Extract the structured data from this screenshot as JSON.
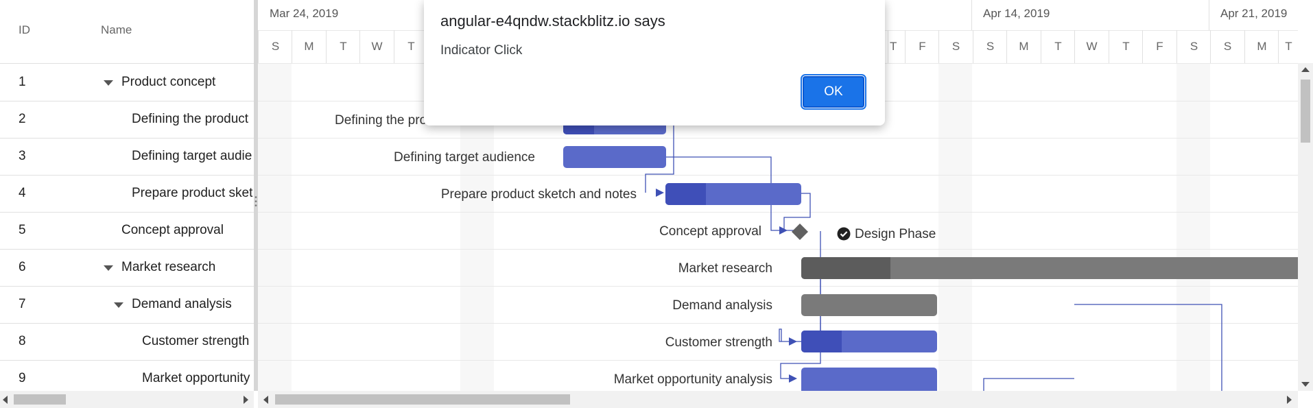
{
  "grid": {
    "columns": {
      "id": "ID",
      "name": "Name"
    },
    "rows": [
      {
        "id": "1",
        "name": "Product concept",
        "expandable": true
      },
      {
        "id": "2",
        "name": "Defining the product",
        "expandable": false
      },
      {
        "id": "3",
        "name": "Defining target audie",
        "expandable": false
      },
      {
        "id": "4",
        "name": "Prepare product sket",
        "expandable": false
      },
      {
        "id": "5",
        "name": "Concept approval",
        "expandable": false
      },
      {
        "id": "6",
        "name": "Market research",
        "expandable": true
      },
      {
        "id": "7",
        "name": "Demand analysis",
        "expandable": true
      },
      {
        "id": "8",
        "name": "Customer strength",
        "expandable": false
      },
      {
        "id": "9",
        "name": "Market opportunity",
        "expandable": false
      }
    ]
  },
  "chart": {
    "weeks": [
      "Mar 24, 2019",
      "Apr 14, 2019",
      "Apr 21, 2019"
    ],
    "days_left": [
      "S",
      "M",
      "T",
      "W",
      "T"
    ],
    "days_right": [
      "T",
      "F",
      "S",
      "S",
      "M",
      "T",
      "W",
      "T",
      "F",
      "S",
      "S",
      "M",
      "T"
    ],
    "task_labels": {
      "defining_product": "Defining the pro",
      "defining_audience": "Defining target audience",
      "prepare_sketch": "Prepare product sketch and notes",
      "concept_approval": "Concept approval",
      "market_research": "Market research",
      "demand_analysis": "Demand analysis",
      "customer_strength": "Customer strength",
      "market_opportunity": "Market opportunity analysis"
    },
    "indicator": {
      "label": "Design Phase",
      "icon": "check-circle-icon"
    },
    "progress": {
      "defining_product": 0.3,
      "prepare_sketch": 0.3,
      "market_research": 0.18,
      "customer_strength": 0.3
    },
    "colors": {
      "task": "#5a6ac9",
      "task_progress": "#3f4fb8",
      "parent": "#7a7a7a",
      "parent_progress": "#5c5c5c",
      "connector": "#3f51b5"
    }
  },
  "dialog": {
    "title": "angular-e4qndw.stackblitz.io says",
    "message": "Indicator Click",
    "ok_label": "OK"
  }
}
